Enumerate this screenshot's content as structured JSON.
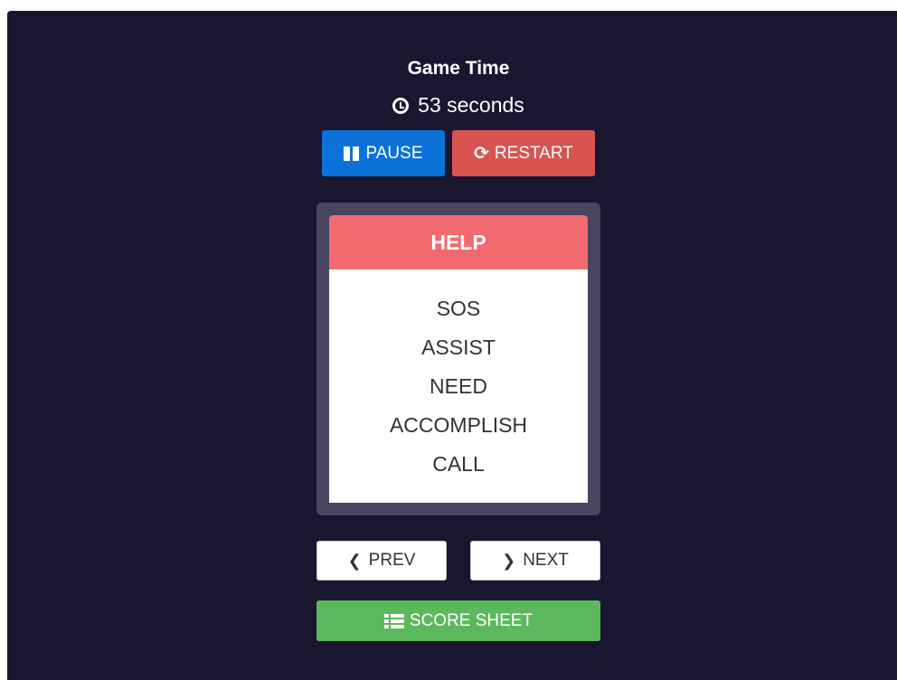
{
  "timer": {
    "title": "Game Time",
    "value": "53 seconds",
    "icon": "clock-icon"
  },
  "controls": {
    "pause_label": "PAUSE",
    "restart_label": "RESTART"
  },
  "card": {
    "title": "HELP",
    "words": [
      "SOS",
      "ASSIST",
      "NEED",
      "ACCOMPLISH",
      "CALL"
    ]
  },
  "nav": {
    "prev_label": "PREV",
    "next_label": "NEXT"
  },
  "score": {
    "label": "SCORE SHEET"
  },
  "colors": {
    "background": "#1a1630",
    "pause": "#0b72d9",
    "restart": "#d9534f",
    "card_header": "#f26a6f",
    "score": "#5cb85c"
  }
}
